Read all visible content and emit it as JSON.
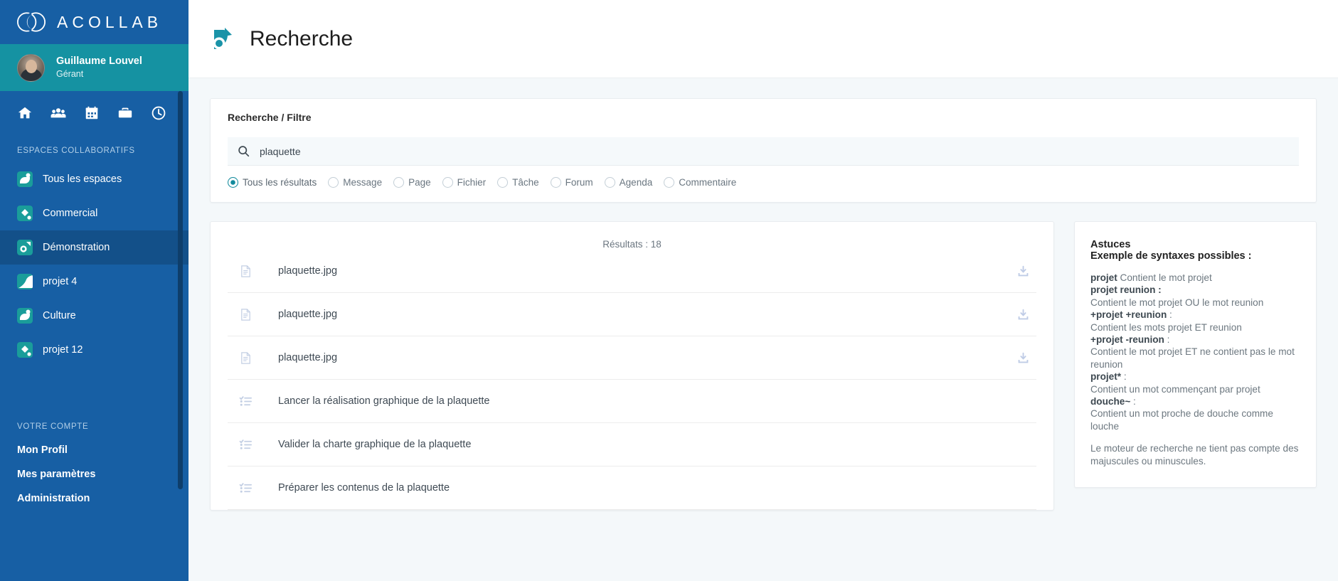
{
  "brand": {
    "name": "ACOLLAB",
    "logo_icon": "acollab-rings-logo"
  },
  "profile": {
    "name": "Guillaume Louvel",
    "role": "Gérant",
    "avatar_icon": "user-avatar"
  },
  "quicknav": [
    {
      "name": "home-icon",
      "label": "Accueil"
    },
    {
      "name": "users-icon",
      "label": "Membres"
    },
    {
      "name": "calendar-icon",
      "label": "Agenda"
    },
    {
      "name": "briefcase-icon",
      "label": "Projets"
    },
    {
      "name": "clock-icon",
      "label": "Temps"
    }
  ],
  "sidebar": {
    "spaces_title": "ESPACES COLLABORATIFS",
    "spaces": [
      {
        "label": "Tous les espaces",
        "icon": "space-leaf-icon",
        "active": false
      },
      {
        "label": "Commercial",
        "icon": "space-diamond-icon",
        "active": false
      },
      {
        "label": "Démonstration",
        "icon": "space-circle-icon",
        "active": true
      },
      {
        "label": "projet 4",
        "icon": "space-wave-icon",
        "active": false
      },
      {
        "label": "Culture",
        "icon": "space-leaf-icon",
        "active": false
      },
      {
        "label": "projet 12",
        "icon": "space-diamond-icon",
        "active": false
      }
    ],
    "account_title": "VOTRE COMPTE",
    "account_items": [
      {
        "label": "Mon Profil"
      },
      {
        "label": "Mes paramètres"
      },
      {
        "label": "Administration"
      }
    ]
  },
  "topbar": {
    "title": "Recherche",
    "logo_icon": "search-module-logo"
  },
  "filter": {
    "panel_title": "Recherche / Filtre",
    "search_icon": "search-icon",
    "search_value": "plaquette",
    "search_placeholder": "",
    "options": [
      {
        "label": "Tous les résultats",
        "checked": true
      },
      {
        "label": "Message",
        "checked": false
      },
      {
        "label": "Page",
        "checked": false
      },
      {
        "label": "Fichier",
        "checked": false
      },
      {
        "label": "Tâche",
        "checked": false
      },
      {
        "label": "Forum",
        "checked": false
      },
      {
        "label": "Agenda",
        "checked": false
      },
      {
        "label": "Commentaire",
        "checked": false
      }
    ]
  },
  "results": {
    "count_label": "Résultats : 18",
    "rows": [
      {
        "label": "plaquette.jpg",
        "icon": "file-icon",
        "action_icon": "download-icon",
        "has_action": true
      },
      {
        "label": "plaquette.jpg",
        "icon": "file-icon",
        "action_icon": "download-icon",
        "has_action": true
      },
      {
        "label": "plaquette.jpg",
        "icon": "file-icon",
        "action_icon": "download-icon",
        "has_action": true
      },
      {
        "label": "Lancer la réalisation graphique de la plaquette",
        "icon": "task-list-icon",
        "action_icon": "",
        "has_action": false
      },
      {
        "label": "Valider la charte graphique de la plaquette",
        "icon": "task-list-icon",
        "action_icon": "",
        "has_action": false
      },
      {
        "label": "Préparer les contenus de la plaquette",
        "icon": "task-list-icon",
        "action_icon": "",
        "has_action": false
      }
    ]
  },
  "tips": {
    "heading": "Astuces",
    "subheading": "Exemple de syntaxes possibles :",
    "lines": [
      {
        "term": "projet",
        "sep": ":",
        "desc": " Contient le mot projet",
        "inline": true
      },
      {
        "term": "projet reunion",
        "sep": " :",
        "desc": "Contient le mot projet OU le mot reunion",
        "inline": false
      },
      {
        "term": "+projet +reunion",
        "sep": " :",
        "desc": "Contient les mots projet ET reunion",
        "inline": false
      },
      {
        "term": "+projet -reunion",
        "sep": " :",
        "desc": "Contient le mot projet ET ne contient pas le mot reunion",
        "inline": false
      },
      {
        "term": "projet*",
        "sep": " :",
        "desc": "Contient un mot commençant par projet",
        "inline": false
      },
      {
        "term": "douche~",
        "sep": " :",
        "desc": "Contient un mot proche de douche comme louche",
        "inline": false
      }
    ],
    "note": "Le moteur de recherche ne tient pas compte des majuscules ou minuscules."
  },
  "colors": {
    "sidebar_blue": "#175fa4",
    "profile_teal": "#1592a2",
    "active_blue": "#135089",
    "accent_teal": "#128a9c",
    "page_bg": "#f4f8fa"
  }
}
